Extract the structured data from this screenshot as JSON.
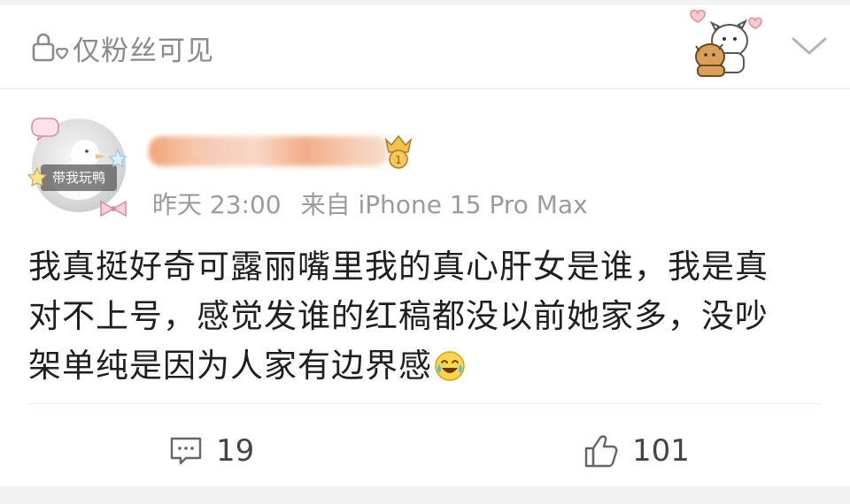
{
  "header": {
    "visibility_label": "仅粉丝可见"
  },
  "post": {
    "avatar_tag": "带我玩鸭",
    "time": "昨天 23:00",
    "source": "来自 iPhone 15 Pro Max",
    "text_line1": "我真挺好奇可露丽嘴里我的真心肝女是谁，我是真",
    "text_line2": "对不上号，感觉发谁的红稿都没以前她家多，没吵",
    "text_line3": "架单纯是因为人家有边界感",
    "emoji_name": "laugh-cry-icon"
  },
  "actions": {
    "comment_count": "19",
    "like_count": "101"
  },
  "colors": {
    "meta_gray": "#9b9b9b",
    "username_blur": "#f39a6b",
    "badge_gold": "#e0a43a"
  }
}
